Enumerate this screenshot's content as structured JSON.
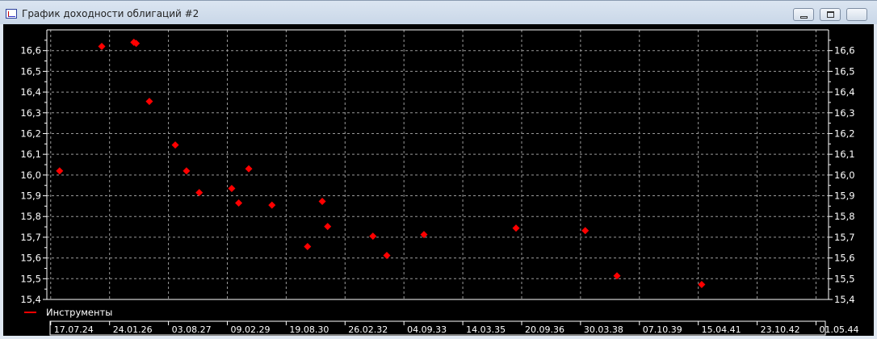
{
  "window": {
    "title": "График доходности облигаций #2"
  },
  "chart_data": {
    "type": "scatter",
    "title": "",
    "xlabel": "",
    "ylabel": "",
    "ylim": [
      15.4,
      16.7
    ],
    "yticks": [
      "15,4",
      "15,5",
      "15,6",
      "15,7",
      "15,8",
      "15,9",
      "16,0",
      "16,1",
      "16,2",
      "16,3",
      "16,4",
      "16,5",
      "16,6"
    ],
    "xlim": [
      2024.44,
      2044.65
    ],
    "xtick_start": 2024.54,
    "xtick_step": 1.522,
    "xticks": [
      "17.07.24",
      "24.01.26",
      "03.08.27",
      "09.02.29",
      "19.08.30",
      "26.02.32",
      "04.09.33",
      "14.03.35",
      "20.09.36",
      "30.03.38",
      "07.10.39",
      "15.04.41",
      "23.10.42",
      "01.05.44"
    ],
    "grid": true,
    "legend": {
      "position": "bottom-left",
      "entries": [
        {
          "label": "Инструменты",
          "color": "#ff0000"
        }
      ]
    },
    "series": [
      {
        "name": "Инструменты",
        "color": "#ff0000",
        "marker": "diamond",
        "points": [
          [
            2024.77,
            16.02
          ],
          [
            2025.86,
            16.62
          ],
          [
            2026.69,
            16.64
          ],
          [
            2026.75,
            16.635
          ],
          [
            2027.09,
            16.355
          ],
          [
            2027.76,
            16.145
          ],
          [
            2028.05,
            16.02
          ],
          [
            2028.38,
            15.915
          ],
          [
            2029.22,
            15.935
          ],
          [
            2029.4,
            15.865
          ],
          [
            2029.66,
            16.03
          ],
          [
            2030.26,
            15.855
          ],
          [
            2031.18,
            15.655
          ],
          [
            2031.56,
            15.873
          ],
          [
            2031.7,
            15.752
          ],
          [
            2032.87,
            15.705
          ],
          [
            2033.23,
            15.612
          ],
          [
            2034.19,
            15.713
          ],
          [
            2036.57,
            15.744
          ],
          [
            2038.36,
            15.732
          ],
          [
            2039.18,
            15.514
          ],
          [
            2041.37,
            15.472
          ]
        ]
      }
    ]
  }
}
